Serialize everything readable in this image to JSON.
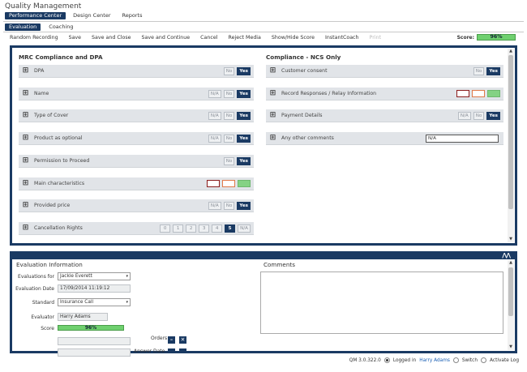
{
  "app": {
    "title": "Quality Management"
  },
  "nav_top": [
    {
      "label": "Performance Center",
      "active": true
    },
    {
      "label": "Design Center",
      "active": false
    },
    {
      "label": "Reports",
      "active": false
    }
  ],
  "nav_sub": [
    {
      "label": "Evaluation",
      "active": true
    },
    {
      "label": "Coaching",
      "active": false
    }
  ],
  "toolbar": {
    "items": [
      "Random Recording",
      "Save",
      "Save and Close",
      "Save and Continue",
      "Cancel",
      "Reject Media",
      "Show/Hide Score",
      "InstantCoach",
      "Print"
    ],
    "disabled": [
      "Print"
    ],
    "score_label": "Score:",
    "score_value": "96%"
  },
  "left_section": {
    "title": "MRC Compliance and DPA",
    "rows": [
      {
        "label": "DPA",
        "options": [
          "No",
          "Yes"
        ],
        "selected": "Yes"
      },
      {
        "label": "Name",
        "options": [
          "N/A",
          "No",
          "Yes"
        ],
        "selected": "Yes"
      },
      {
        "label": "Type of Cover",
        "options": [
          "N/A",
          "No",
          "Yes"
        ],
        "selected": "Yes"
      },
      {
        "label": "Product as optional",
        "options": [
          "N/A",
          "No",
          "Yes"
        ],
        "selected": "Yes"
      },
      {
        "label": "Permission to Proceed",
        "options": [
          "No",
          "Yes"
        ],
        "selected": "Yes"
      },
      {
        "label": "Main characteristics",
        "color_boxes": true
      },
      {
        "label": "Provided price",
        "options": [
          "N/A",
          "No",
          "Yes"
        ],
        "selected": "Yes"
      },
      {
        "label": "Cancellation Rights",
        "options": [
          "0",
          "1",
          "2",
          "3",
          "4",
          "5",
          "N/A"
        ],
        "selected": "5"
      }
    ]
  },
  "right_section": {
    "title": "Compliance - NCS Only",
    "rows": [
      {
        "label": "Customer consent",
        "options": [
          "No",
          "Yes"
        ],
        "selected": "Yes"
      },
      {
        "label": "Record Responses / Relay Information",
        "color_boxes": true
      },
      {
        "label": "Payment Details",
        "options": [
          "N/A",
          "No",
          "Yes"
        ],
        "selected": "Yes"
      },
      {
        "label": "Any other comments",
        "text_value": "N/A"
      }
    ]
  },
  "colors": {
    "accent": "#1a3a63",
    "score_green": "#6fd06f"
  },
  "eval_info": {
    "title": "Evaluation Information",
    "evaluations_for_label": "Evaluations for",
    "evaluations_for_value": "Jackie Everett",
    "evaluation_date_label": "Evaluation Date",
    "evaluation_date_value": "17/09/2014 11:19:12",
    "standard_label": "Standard",
    "standard_value": "Insurance Call",
    "evaluator_label": "Evaluator",
    "evaluator_value": "Harry Adams",
    "score_label": "Score",
    "score_value": "96%",
    "orders_label": "Orders",
    "partial_label": "Answer Date..."
  },
  "comments": {
    "title": "Comments"
  },
  "footer": {
    "version": "QM 3.0.322.0",
    "logged_in_label": "Logged in",
    "user": "Harry Adams",
    "switch_label": "Switch",
    "activate_log_label": "Activate Log"
  }
}
